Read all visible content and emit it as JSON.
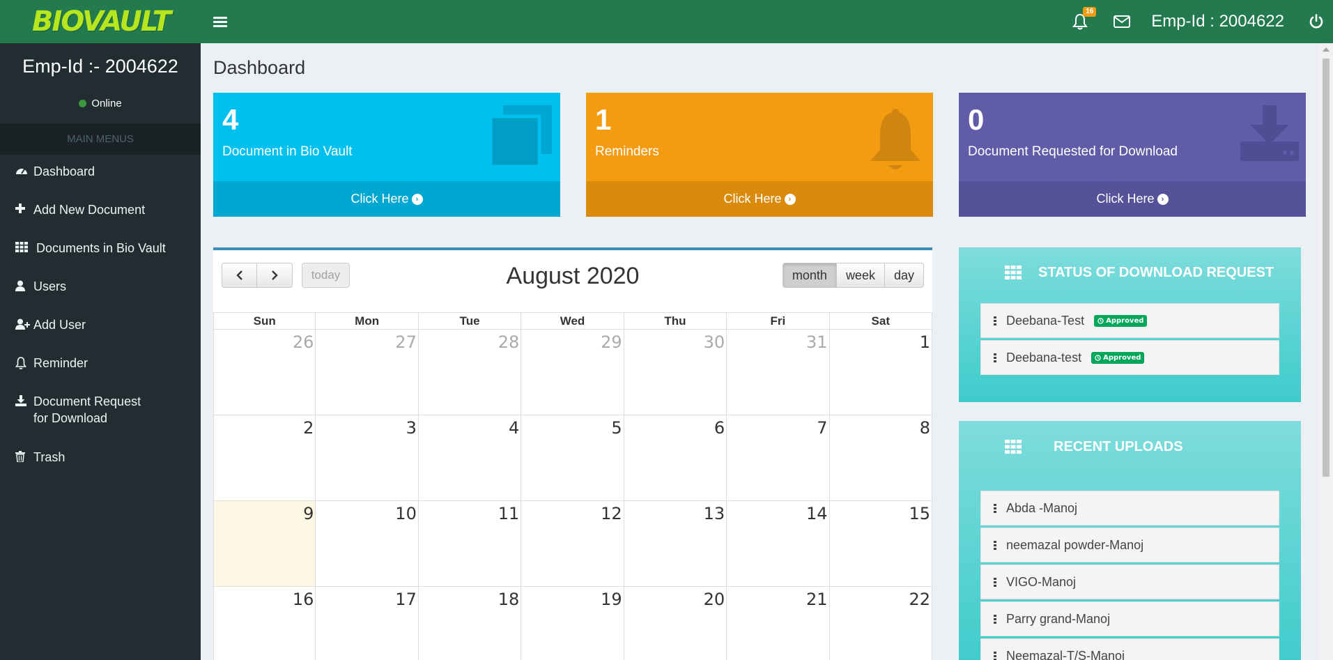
{
  "app": {
    "logo": "BIOVAULT",
    "notifications_count": "16",
    "top_user": "Emp-Id : 2004622"
  },
  "sidebar": {
    "user": "Emp-Id :- 2004622",
    "status": "Online",
    "header": "MAIN MENUS",
    "items": [
      {
        "label": "Dashboard",
        "icon": "dashboard-icon"
      },
      {
        "label": "Add New Document",
        "icon": "plus-icon"
      },
      {
        "label": "Documents in Bio Vault",
        "icon": "grid-icon"
      },
      {
        "label": "Users",
        "icon": "user-icon"
      },
      {
        "label": "Add User",
        "icon": "user-plus-icon"
      },
      {
        "label": "Reminder",
        "icon": "bell-icon"
      },
      {
        "label": "Document Request for Download",
        "icon": "download-icon"
      },
      {
        "label": "Trash",
        "icon": "trash-icon"
      }
    ]
  },
  "page": {
    "title": "Dashboard"
  },
  "stats": [
    {
      "number": "4",
      "label": "Document in Bio Vault",
      "footer": "Click Here",
      "color": "#00c0ef",
      "footer_color": "#00a7d0"
    },
    {
      "number": "1",
      "label": "Reminders",
      "footer": "Click Here",
      "color": "#f39c12",
      "footer_color": "#db8b0b"
    },
    {
      "number": "0",
      "label": "Document Requested for Download",
      "footer": "Click Here",
      "color": "#605ca8",
      "footer_color": "#555299"
    }
  ],
  "calendar": {
    "title": "August 2020",
    "today_label": "today",
    "views": [
      "month",
      "week",
      "day"
    ],
    "active_view": "month",
    "days_of_week": [
      "Sun",
      "Mon",
      "Tue",
      "Wed",
      "Thu",
      "Fri",
      "Sat"
    ],
    "weeks": [
      [
        "26",
        "27",
        "28",
        "29",
        "30",
        "31",
        "1"
      ],
      [
        "2",
        "3",
        "4",
        "5",
        "6",
        "7",
        "8"
      ],
      [
        "9",
        "10",
        "11",
        "12",
        "13",
        "14",
        "15"
      ],
      [
        "16",
        "17",
        "18",
        "19",
        "20",
        "21",
        "22"
      ]
    ]
  },
  "download_status": {
    "title": "STATUS OF DOWNLOAD REQUEST",
    "items": [
      {
        "name": "Deebana-Test",
        "status": "Approved"
      },
      {
        "name": "Deebana-test",
        "status": "Approved"
      }
    ]
  },
  "recent_uploads": {
    "title": "RECENT UPLOADS",
    "items": [
      "Abda -Manoj",
      "neemazal powder-Manoj",
      "VIGO-Manoj",
      "Parry grand-Manoj",
      "Neemazal-T/S-Manoj"
    ]
  }
}
